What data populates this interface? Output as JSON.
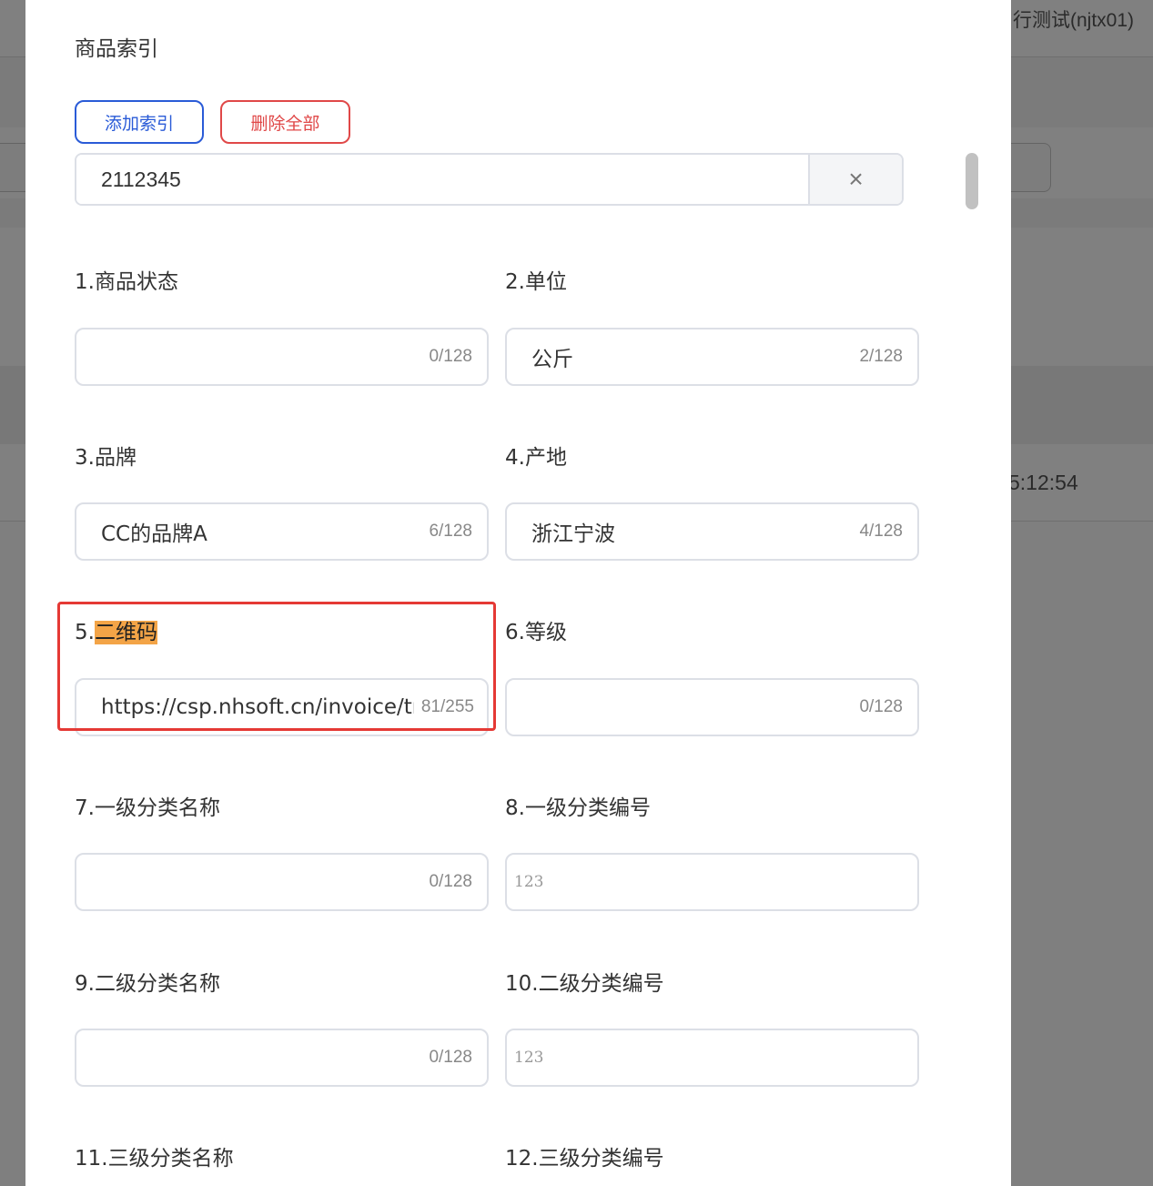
{
  "background": {
    "user_label": "行测试(njtx01)",
    "time_text": "5:12:54"
  },
  "drawer": {
    "section_title": "商品索引",
    "buttons": {
      "add_index": "添加索引",
      "delete_all": "删除全部"
    },
    "index_value": "2112345",
    "clear_symbol": "×",
    "fields": [
      {
        "label": "1.商品状态",
        "value": "",
        "count": "0/128"
      },
      {
        "label": "2.单位",
        "value": "公斤",
        "count": "2/128"
      },
      {
        "label": "3.品牌",
        "value": "CC的品牌A",
        "count": "6/128"
      },
      {
        "label": "4.产地",
        "value": "浙江宁波",
        "count": "4/128"
      },
      {
        "label_prefix": "5.",
        "label_highlight": "二维码",
        "value": "https://csp.nhsoft.cn/invoice/tra",
        "count": "81/255"
      },
      {
        "label": "6.等级",
        "value": "",
        "count": "0/128"
      },
      {
        "label": "7.一级分类名称",
        "value": "",
        "count": "0/128"
      },
      {
        "label": "8.一级分类编号",
        "placeholder": "123"
      },
      {
        "label": "9.二级分类名称",
        "value": "",
        "count": "0/128"
      },
      {
        "label": "10.二级分类编号",
        "placeholder": "123"
      },
      {
        "label": "11.三级分类名称"
      },
      {
        "label": "12.三级分类编号"
      }
    ]
  }
}
